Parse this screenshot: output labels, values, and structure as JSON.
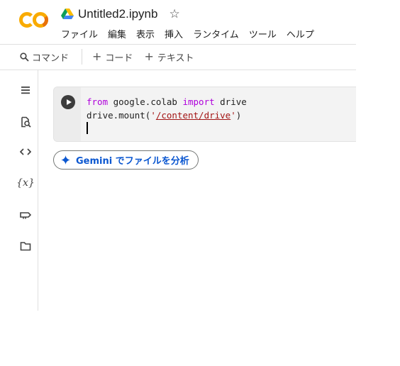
{
  "app": {
    "logo_text": "CO",
    "doc_title": "Untitled2.ipynb",
    "brand_colors": {
      "orange": "#f9ab00",
      "accent": "#0b57d0"
    }
  },
  "menu": [
    "ファイル",
    "編集",
    "表示",
    "挿入",
    "ランタイム",
    "ツール",
    "ヘルプ"
  ],
  "toolbar": {
    "command_label": "コマンド",
    "code_label": "コード",
    "text_label": "テキスト"
  },
  "sidebar": {
    "icons": [
      "menu-icon",
      "search-icon",
      "code-snippets-icon",
      "variables-icon",
      "secrets-key-icon",
      "folder-icon"
    ],
    "variables_glyph": "{x}"
  },
  "cell": {
    "line1": {
      "kw1": "from",
      "module": " google.colab ",
      "kw2": "import",
      "name": " drive"
    },
    "line2": {
      "prefix": "drive.mount(",
      "q1": "'",
      "path": "/content/drive",
      "q2": "'",
      "suffix": ")"
    }
  },
  "gemini": {
    "label": "Gemini でファイルを分析"
  }
}
